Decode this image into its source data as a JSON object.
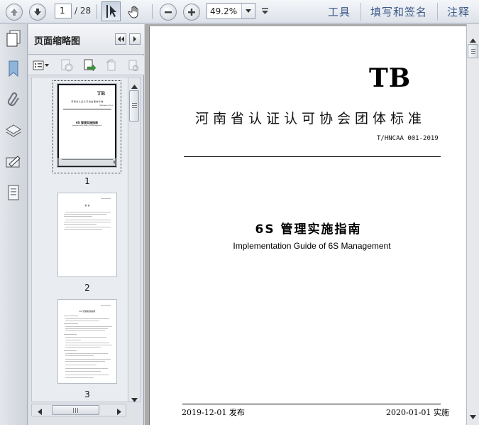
{
  "toolbar": {
    "page_current": "1",
    "page_total": "/ 28",
    "zoom": "49.2%",
    "tools_label": "工具",
    "fill_sign_label": "填写和签名",
    "comment_label": "注释"
  },
  "panel": {
    "title": "页面缩略图",
    "thumbnails": [
      {
        "label": "1",
        "header": "TB",
        "org": "河南省认证认可协会团体标准",
        "code": "T/HNCAA 001-2019",
        "title": "6S 管理实施指南",
        "subtitle": "Implementation Guide of 6S Management"
      },
      {
        "label": "2",
        "heading": "前  言"
      },
      {
        "label": "3",
        "heading": "6S 管理实施指南"
      }
    ]
  },
  "document": {
    "header": "TB",
    "organization": "河南省认证认可协会团体标准",
    "code": "T/HNCAA 001-2019",
    "title_cn": "6S 管理实施指南",
    "title_en": "Implementation Guide of 6S Management",
    "publish_date": "2019-12-01 发布",
    "effective_date": "2020-01-01 实施"
  },
  "colors": {
    "toolbar_link": "#3c5a89",
    "doc_background": "#ababab",
    "page": "#ffffff"
  }
}
